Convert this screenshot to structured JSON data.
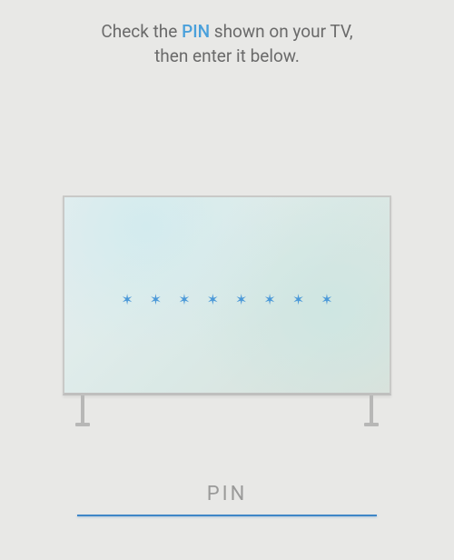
{
  "heading": {
    "prefix": "Check the ",
    "highlight": "PIN",
    "suffix_line1": " shown on your TV,",
    "line2": "then enter it below."
  },
  "tv": {
    "masked_digit_count": 8,
    "star_glyph": "✶"
  },
  "pin_input": {
    "placeholder": "PIN",
    "value": ""
  },
  "colors": {
    "accent": "#4aa0db",
    "underline": "#3f86c7",
    "text_muted": "#6a6a6a",
    "bg": "#e8e8e6"
  }
}
